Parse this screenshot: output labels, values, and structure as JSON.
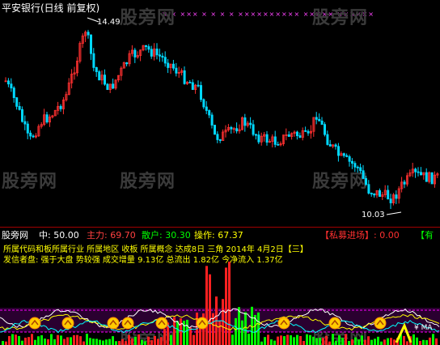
{
  "header": {
    "title": "平安银行(日线 前复权)",
    "marks": "×  ×    ×××   ×  × ×   ×  ××××××××××  ×××××  ××××××"
  },
  "watermarks": [
    "股旁网",
    "股旁网",
    "股旁网",
    "股旁网",
    "股旁网",
    "股旁网",
    "股旁网"
  ],
  "price_chart": {
    "high_label": "14.49",
    "low_label": "10.03"
  },
  "indicator_bar": {
    "site": "股旁网",
    "zhong": "中: 50.00",
    "zhuli": "主力: 69.70",
    "sanhu": "散户: 30.30",
    "caozuo": "操作: 67.37",
    "alert": "【私募进场】: 0.00",
    "extra": "【有"
  },
  "info_lines": {
    "line1": "所属代码和板所属行业 所属地区 收板 所属概念 达成8日 三角 2014年 4月2日【三】",
    "line2": "发信者盘:    强于大盘 势较强 成交增量       9.13亿  总流出 1.82亿  今净流入 1.37亿"
  },
  "lower_icons": {
    "label": "¥ MA"
  },
  "colors": {
    "up": "#ff3030",
    "down": "#00d8ff",
    "accent_yellow": "#ffff00",
    "accent_green": "#00ff00",
    "accent_magenta": "#ff00ff",
    "red_alert": "#ff3030"
  }
}
